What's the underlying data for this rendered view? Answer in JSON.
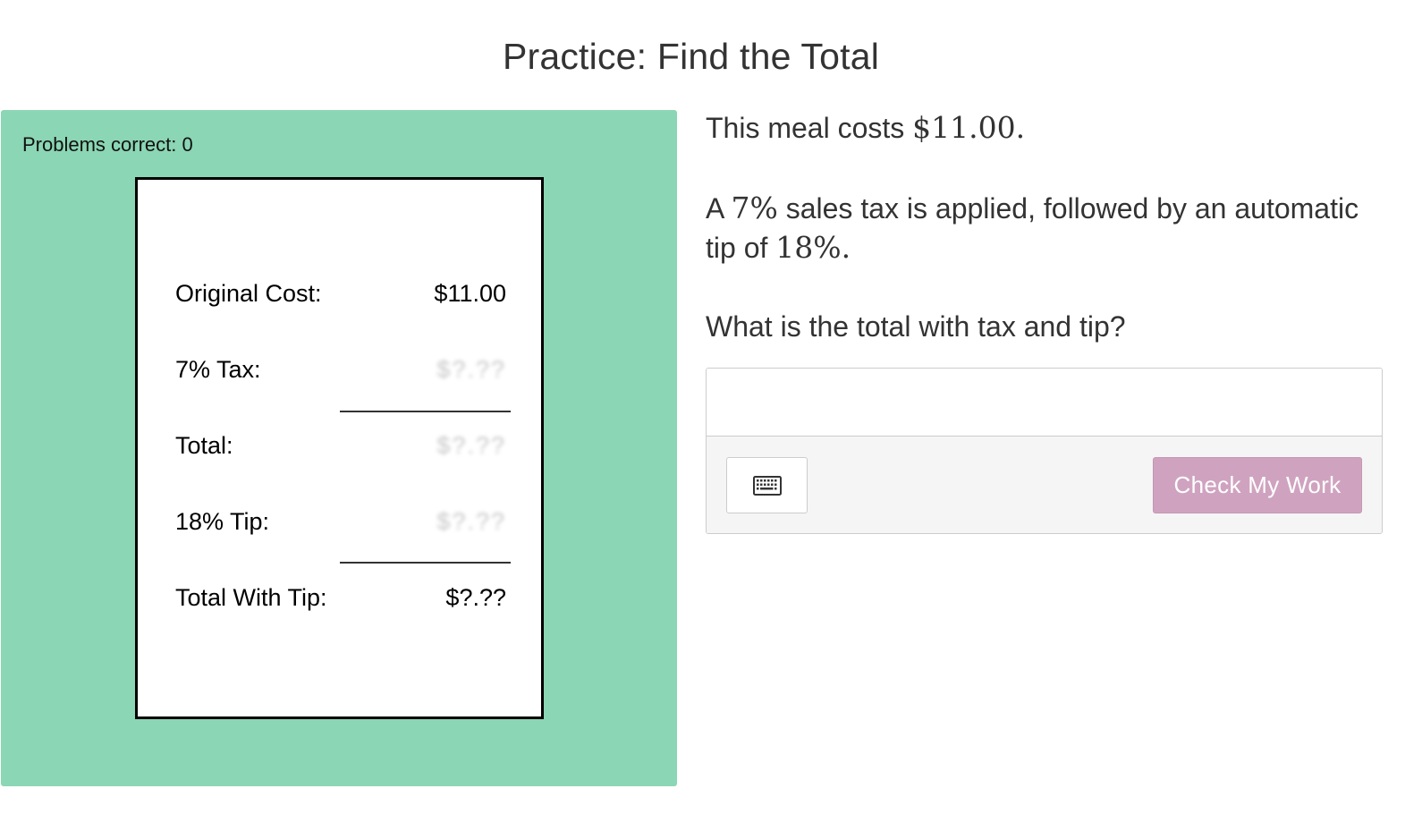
{
  "title": "Practice: Find the Total",
  "score": {
    "text": "Problems correct: 0"
  },
  "receipt": {
    "rows": [
      {
        "label": "Original Cost:",
        "value": "$11.00",
        "hidden": false
      },
      {
        "label": "7% Tax:",
        "value": "$?.??",
        "hidden": true
      },
      {
        "label": "Total:",
        "value": "$?.??",
        "hidden": true
      },
      {
        "label": "18% Tip:",
        "value": "$?.??",
        "hidden": true
      },
      {
        "label": "Total With Tip:",
        "value": "$?.??",
        "hidden": false
      }
    ]
  },
  "question": {
    "line1_prefix": "This meal costs ",
    "meal_cost": "$11.00.",
    "line2_a": "A ",
    "tax_rate": "7%",
    "line2_b": " sales tax is applied, followed by an automatic tip of ",
    "tip_rate": "18%.",
    "prompt": "What is the total with tax and tip?"
  },
  "answer": {
    "value": "",
    "placeholder": ""
  },
  "toolbar": {
    "keyboard_icon": "keyboard-icon",
    "check_label": "Check My Work"
  },
  "colors": {
    "panel": "#8bd6b4",
    "check_button": "#cfa3bf",
    "toolbar_bg": "#f5f5f5"
  }
}
